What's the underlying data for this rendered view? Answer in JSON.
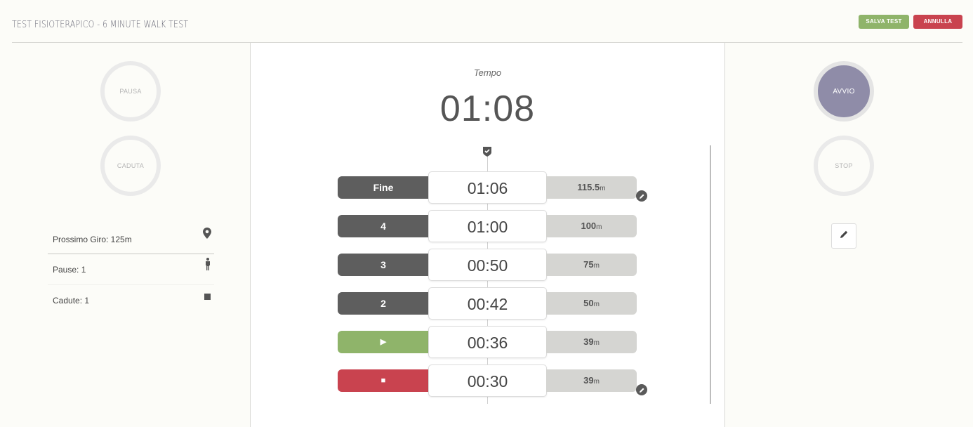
{
  "header": {
    "title": "TEST FISIOTERAPICO - 6 MINUTE WALK TEST",
    "save_label": "SALVA TEST",
    "cancel_label": "ANNULLA"
  },
  "left": {
    "pause_label": "PAUSA",
    "fall_label": "CADUTA",
    "info": [
      {
        "label": "Prossimo Giro: 125m",
        "icon": "location-pin-icon"
      },
      {
        "label": "Pause: 1",
        "icon": "person-icon"
      },
      {
        "label": "Cadute: 1",
        "icon": "square-icon"
      }
    ]
  },
  "center": {
    "tempo_label": "Tempo",
    "tempo_value": "01:08",
    "laps": [
      {
        "label": "Fine",
        "time": "01:06",
        "distance": "115.5",
        "unit": "m",
        "style": "dark",
        "editable": true
      },
      {
        "label": "4",
        "time": "01:00",
        "distance": "100",
        "unit": "m",
        "style": "dark",
        "editable": false
      },
      {
        "label": "3",
        "time": "00:50",
        "distance": "75",
        "unit": "m",
        "style": "dark",
        "editable": false
      },
      {
        "label": "2",
        "time": "00:42",
        "distance": "50",
        "unit": "m",
        "style": "dark",
        "editable": false
      },
      {
        "label": "▶",
        "time": "00:36",
        "distance": "39",
        "unit": "m",
        "style": "green",
        "editable": false
      },
      {
        "label": "■",
        "time": "00:30",
        "distance": "39",
        "unit": "m",
        "style": "red",
        "editable": true
      }
    ]
  },
  "right": {
    "start_label": "AVVIO",
    "stop_label": "STOP"
  },
  "colors": {
    "accent_green": "#8fb46a",
    "accent_red": "#c9434f",
    "accent_purple": "#8f8ca8",
    "dark_gray": "#5e5e5e"
  }
}
